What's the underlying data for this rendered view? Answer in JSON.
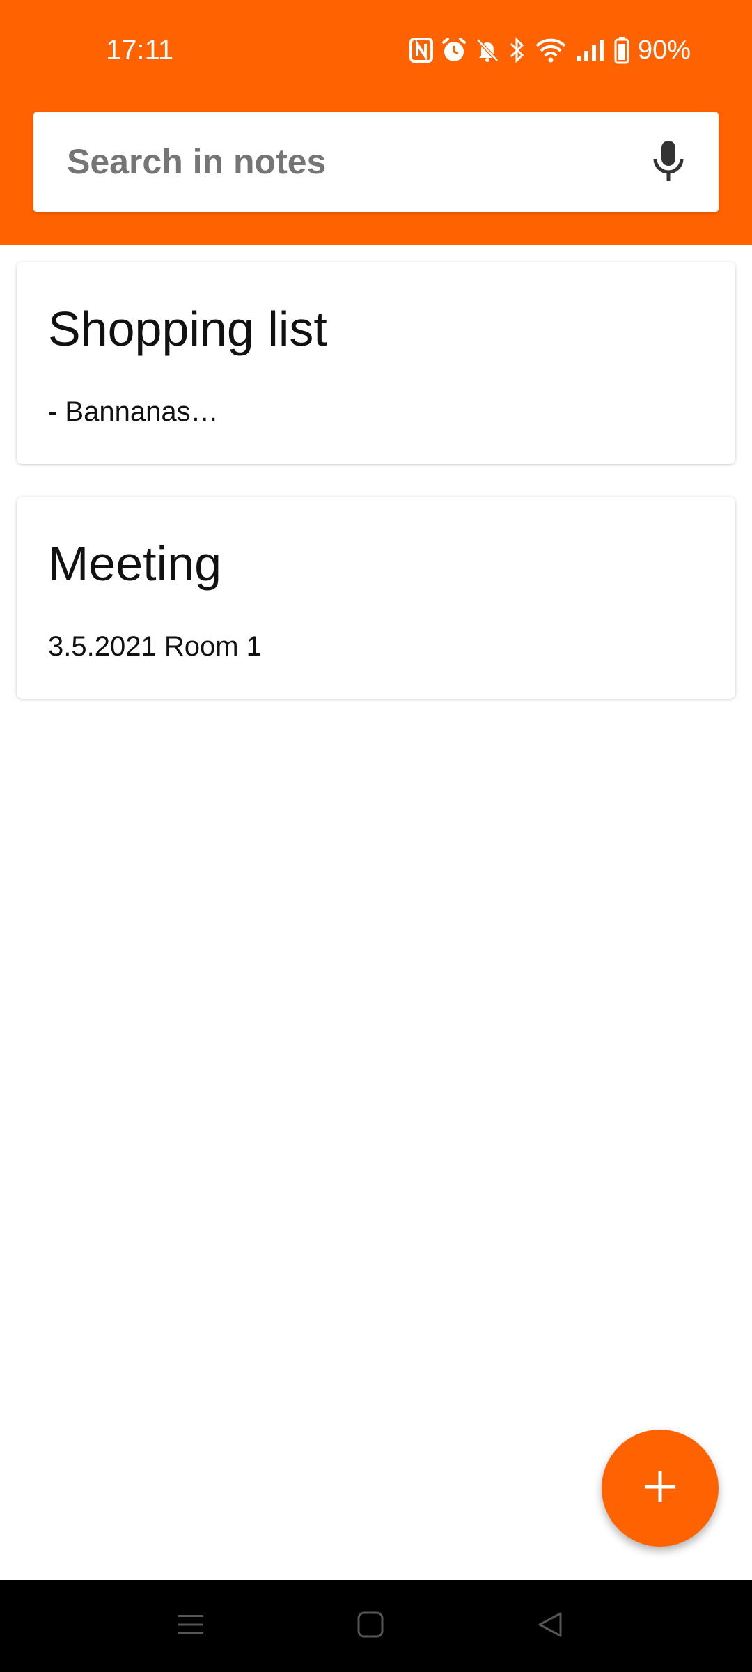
{
  "status_bar": {
    "time": "17:11",
    "battery": "90%",
    "icons": [
      "nfc-icon",
      "alarm-icon",
      "bell-off-icon",
      "bluetooth-icon",
      "wifi-icon",
      "signal-icon",
      "battery-icon"
    ]
  },
  "search": {
    "placeholder": "Search in notes",
    "mic_icon": "mic-icon"
  },
  "notes": [
    {
      "title": "Shopping list",
      "preview": "- Bannanas…"
    },
    {
      "title": "Meeting",
      "preview": "3.5.2021 Room 1"
    }
  ],
  "fab": {
    "icon": "plus-icon"
  },
  "nav": {
    "icons": [
      "menu-icon",
      "home-icon",
      "back-icon"
    ]
  },
  "colors": {
    "accent": "#ff6200",
    "background": "#ffffff",
    "nav_bar": "#000000"
  }
}
